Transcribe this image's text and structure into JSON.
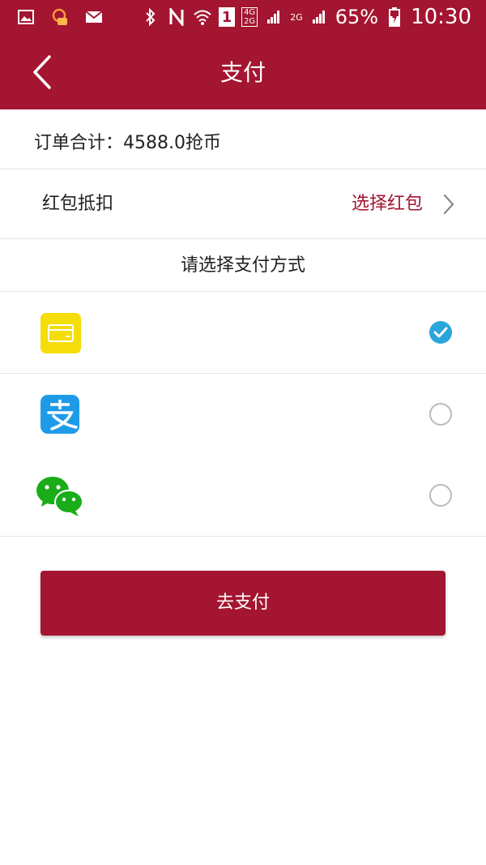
{
  "status_bar": {
    "signal_4g": "4G",
    "signal_2g_a": "2G",
    "signal_2g_b": "2G",
    "sim": "1",
    "battery": "65%",
    "time": "10:30"
  },
  "header": {
    "title": "支付"
  },
  "order": {
    "total_text": "订单合计：4588.0抢币"
  },
  "red_packet": {
    "label": "红包抵扣",
    "choose": "选择红包"
  },
  "payment": {
    "title": "请选择支付方式",
    "methods": [
      {
        "icon": "card-wallet-icon",
        "selected": true
      },
      {
        "icon": "alipay-icon",
        "selected": false
      },
      {
        "icon": "wechat-pay-icon",
        "selected": false
      }
    ]
  },
  "actions": {
    "pay_label": "去支付"
  },
  "colors": {
    "brand": "#a31530",
    "selected": "#2aa6db",
    "divider": "#e6e6e6"
  }
}
